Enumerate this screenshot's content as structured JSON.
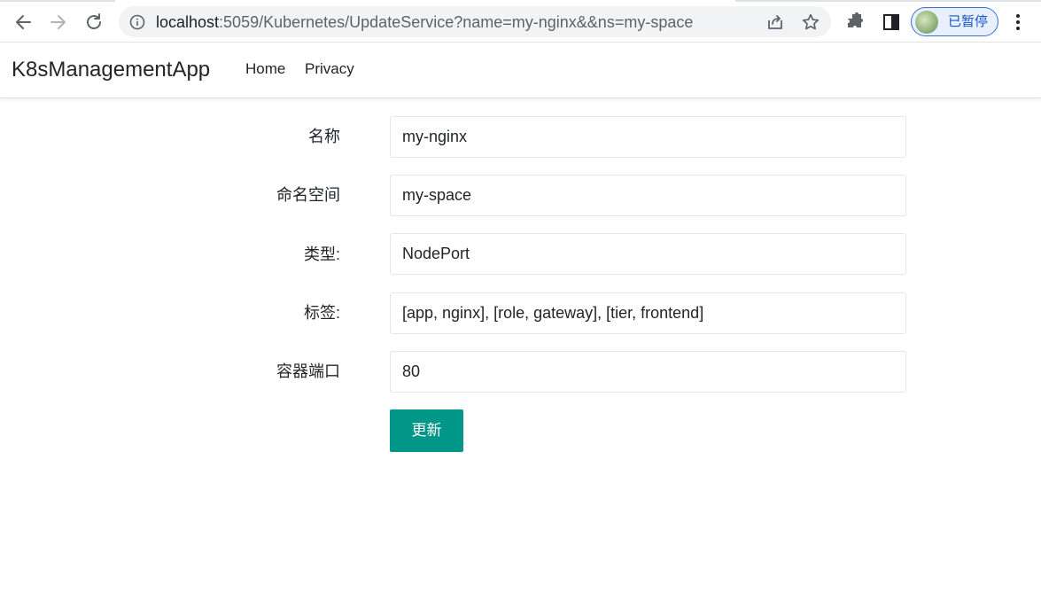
{
  "browser": {
    "url_host": "localhost",
    "url_rest": ":5059/Kubernetes/UpdateService?name=my-nginx&&ns=my-space",
    "profile_label": "已暂停"
  },
  "navbar": {
    "brand": "K8sManagementApp",
    "links": [
      "Home",
      "Privacy"
    ]
  },
  "form": {
    "fields": [
      {
        "label": "名称",
        "value": "my-nginx"
      },
      {
        "label": "命名空间",
        "value": "my-space"
      },
      {
        "label": "类型:",
        "value": "NodePort"
      },
      {
        "label": "标签:",
        "value": "[app, nginx], [role, gateway], [tier, frontend]"
      },
      {
        "label": "容器端口",
        "value": "80"
      }
    ],
    "submit_label": "更新",
    "submit_color": "#009688"
  }
}
